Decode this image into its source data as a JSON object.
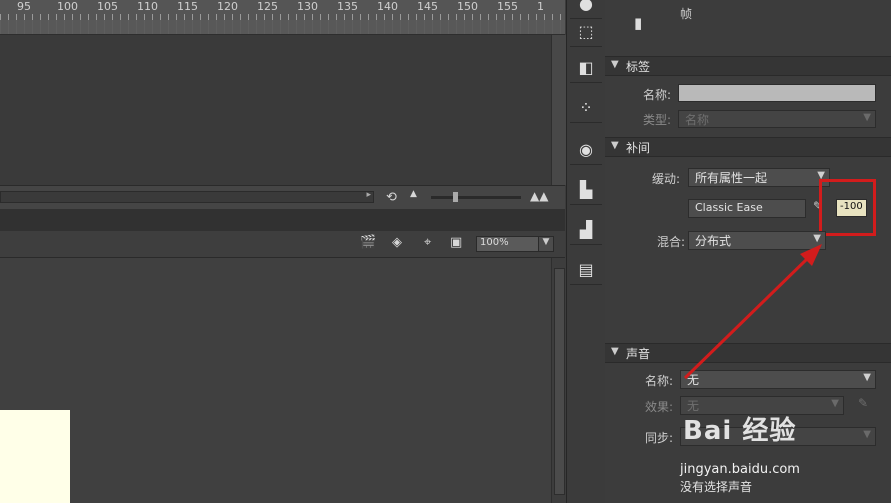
{
  "ruler": {
    "ticks": [
      "95",
      "100",
      "105",
      "110",
      "115",
      "120",
      "125",
      "130",
      "135",
      "140",
      "145",
      "150",
      "155",
      "1"
    ]
  },
  "stage_toolbar": {
    "zoom": "100%"
  },
  "panel": {
    "frame_label": "帧",
    "label_section": {
      "title": "标签",
      "name_label": "名称:",
      "name_value": "",
      "type_label": "类型:",
      "type_value": "名称"
    },
    "tween_section": {
      "title": "补间",
      "ease_label": "缓动:",
      "ease_value": "所有属性一起",
      "ease_preset": "Classic Ease",
      "ease_amount": "-100",
      "blend_label": "混合:",
      "blend_value": "分布式"
    },
    "sound_section": {
      "title": "声音",
      "name_label": "名称:",
      "name_value": "无",
      "effect_label": "效果:",
      "effect_value": "无",
      "sync_label": "同步:",
      "no_sound_text": "没有选择声音"
    }
  },
  "watermark": {
    "brand": "Bai 经验",
    "url": "jingyan.baidu.com"
  },
  "colors": {
    "highlight": "#d21c1c",
    "canvas": "#ffffe8"
  }
}
